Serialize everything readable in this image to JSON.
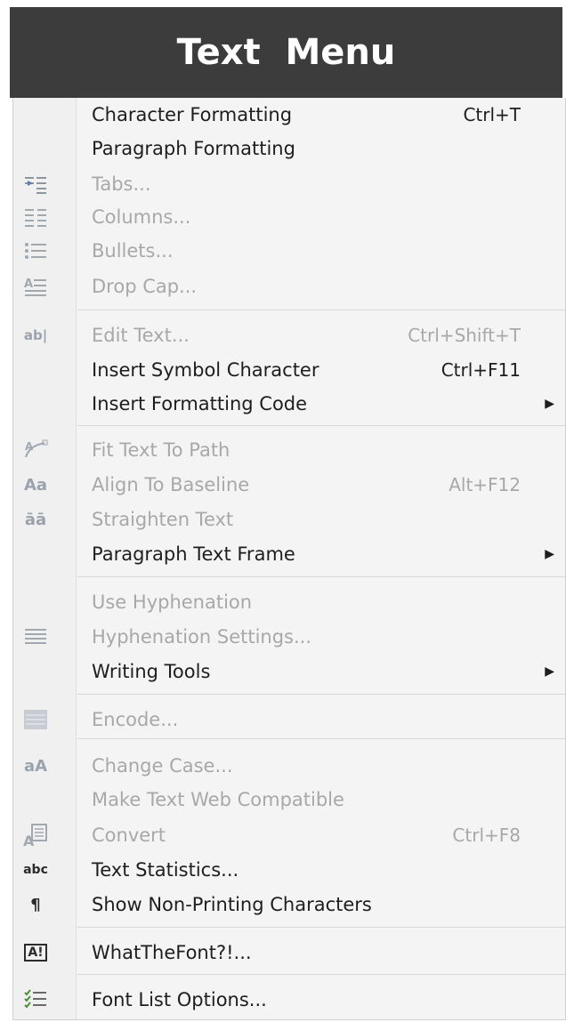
{
  "title": "Text  Menu",
  "items": [
    {
      "label": "Character Formatting",
      "shortcut": "Ctrl+T",
      "icon": null,
      "enabled": true
    },
    {
      "label": "Paragraph Formatting",
      "shortcut": "",
      "icon": null,
      "enabled": true
    },
    {
      "label": "Tabs...",
      "shortcut": "",
      "icon": "tabs-icon",
      "enabled": false
    },
    {
      "label": "Columns...",
      "shortcut": "",
      "icon": "columns-icon",
      "enabled": false
    },
    {
      "label": "Bullets...",
      "shortcut": "",
      "icon": "bullets-icon",
      "enabled": false
    },
    {
      "label": "Drop Cap...",
      "shortcut": "",
      "icon": "drop-cap-icon",
      "enabled": false
    },
    {
      "label": "Edit Text...",
      "shortcut": "Ctrl+Shift+T",
      "icon": "edit-text-icon",
      "enabled": false
    },
    {
      "label": "Insert Symbol Character",
      "shortcut": "Ctrl+F11",
      "icon": null,
      "enabled": true
    },
    {
      "label": "Insert Formatting Code",
      "shortcut": "",
      "icon": null,
      "enabled": true,
      "submenu": true
    },
    {
      "label": "Fit Text To Path",
      "shortcut": "",
      "icon": "fit-text-to-path-icon",
      "enabled": false
    },
    {
      "label": "Align To Baseline",
      "shortcut": "Alt+F12",
      "icon": "align-baseline-icon",
      "enabled": false
    },
    {
      "label": "Straighten Text",
      "shortcut": "",
      "icon": "straighten-text-icon",
      "enabled": false
    },
    {
      "label": "Paragraph Text Frame",
      "shortcut": "",
      "icon": null,
      "enabled": true,
      "submenu": true
    },
    {
      "label": "Use Hyphenation",
      "shortcut": "",
      "icon": null,
      "enabled": false
    },
    {
      "label": "Hyphenation Settings...",
      "shortcut": "",
      "icon": "hyphenation-settings-icon",
      "enabled": false
    },
    {
      "label": "Writing Tools",
      "shortcut": "",
      "icon": null,
      "enabled": true,
      "submenu": true
    },
    {
      "label": "Encode...",
      "shortcut": "",
      "icon": "encode-icon",
      "enabled": false
    },
    {
      "label": "Change Case...",
      "shortcut": "",
      "icon": "change-case-icon",
      "enabled": false
    },
    {
      "label": "Make Text Web Compatible",
      "shortcut": "",
      "icon": null,
      "enabled": false
    },
    {
      "label": "Convert",
      "shortcut": "Ctrl+F8",
      "icon": "convert-icon",
      "enabled": false
    },
    {
      "label": "Text Statistics...",
      "shortcut": "",
      "icon": "text-statistics-icon",
      "enabled": true
    },
    {
      "label": "Show Non-Printing Characters",
      "shortcut": "",
      "icon": "pilcrow-icon",
      "enabled": true
    },
    {
      "label": "WhatTheFont?!...",
      "shortcut": "",
      "icon": "whatthefont-icon",
      "enabled": true
    },
    {
      "label": "Font List Options...",
      "shortcut": "",
      "icon": "font-list-options-icon",
      "enabled": true
    }
  ],
  "icon_glyphs": {
    "edit-text-icon": "ab|",
    "align-baseline-icon": "Aa",
    "straighten-text-icon": "āā",
    "change-case-icon": "aA",
    "text-statistics-icon": "abc",
    "pilcrow-icon": "¶",
    "whatthefont-icon": "A!"
  }
}
